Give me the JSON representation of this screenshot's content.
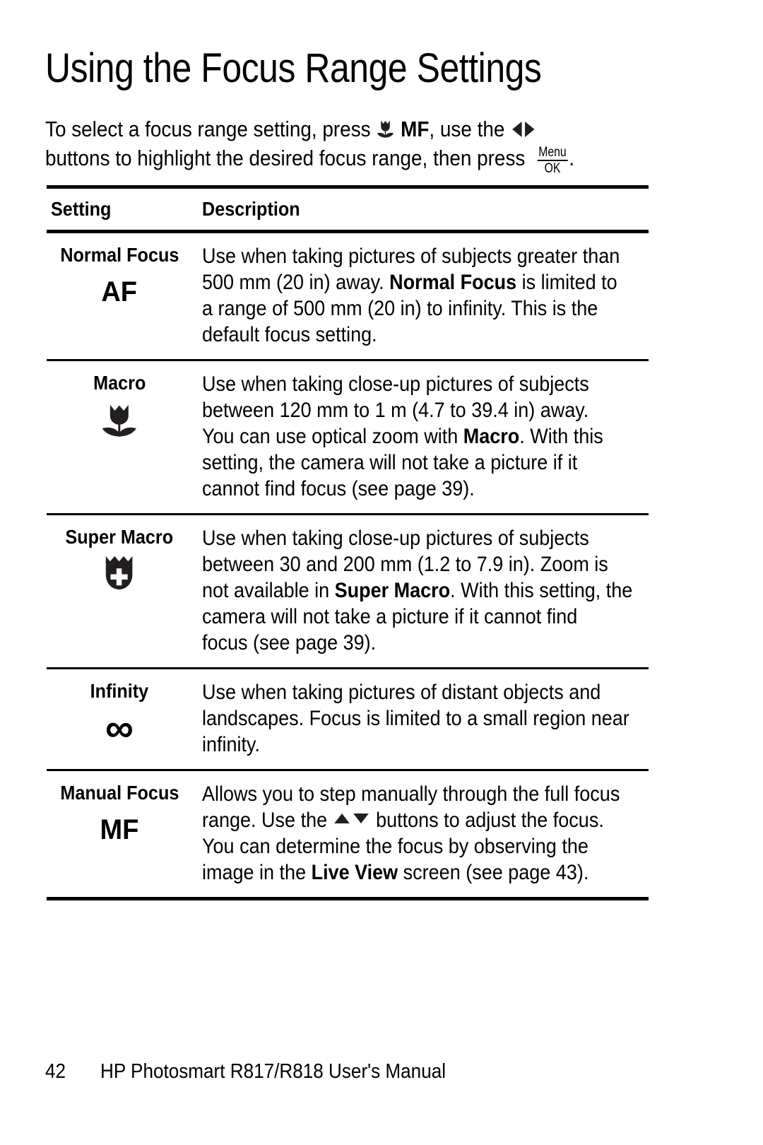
{
  "page": {
    "title": "Using the Focus Range Settings",
    "intro": {
      "line1_a": "To select a focus range setting, press",
      "line1_icon_macro": "macro-tulip-icon",
      "line1_b": "MF",
      "line1_c": ", use the",
      "line1_icon_leftright": "left-right-arrows-icon",
      "line2_a": "buttons to highlight the desired focus range, then press",
      "line2_icon_menuok_top": "Menu",
      "line2_icon_menuok_bottom": "OK",
      "line2_b": "."
    },
    "table": {
      "headers": {
        "setting": "Setting",
        "description": "Description"
      },
      "rows": [
        {
          "setting": "Normal Focus",
          "icon": "AF",
          "icon_kind": "text",
          "description_lines": [
            [
              {
                "t": "Use when taking pictures of subjects greater than",
                "b": false
              }
            ],
            [
              {
                "t": "500 mm (20 in) away. ",
                "b": false
              },
              {
                "t": "Normal Focus",
                "b": true
              },
              {
                "t": " is limited to",
                "b": false
              }
            ],
            [
              {
                "t": "a range of 500 mm (20 in) to infinity. This is the",
                "b": false
              }
            ],
            [
              {
                "t": "default focus setting.",
                "b": false
              }
            ]
          ]
        },
        {
          "setting": "Macro",
          "icon": "macro-tulip-icon",
          "icon_kind": "tulip",
          "description_lines": [
            [
              {
                "t": "Use when taking close-up pictures of subjects",
                "b": false
              }
            ],
            [
              {
                "t": "between 120 mm to 1 m (4.7 to 39.4 in) away.",
                "b": false
              }
            ],
            [
              {
                "t": "You can use optical zoom with ",
                "b": false
              },
              {
                "t": "Macro",
                "b": true
              },
              {
                "t": ". With this",
                "b": false
              }
            ],
            [
              {
                "t": "setting, the camera will not take a picture if it",
                "b": false
              }
            ],
            [
              {
                "t": "cannot find focus (see page 39).",
                "b": false
              }
            ]
          ]
        },
        {
          "setting": "Super Macro",
          "icon": "super-macro-tulip-plus-icon",
          "icon_kind": "tulip-plus",
          "description_lines": [
            [
              {
                "t": "Use when taking close-up pictures of subjects",
                "b": false
              }
            ],
            [
              {
                "t": "between 30 and 200 mm (1.2 to 7.9 in). Zoom is",
                "b": false
              }
            ],
            [
              {
                "t": "not available in ",
                "b": false
              },
              {
                "t": "Super Macro",
                "b": true
              },
              {
                "t": ". With this setting, the",
                "b": false
              }
            ],
            [
              {
                "t": "camera will not take a picture if it cannot find",
                "b": false
              }
            ],
            [
              {
                "t": "focus (see page 39).",
                "b": false
              }
            ]
          ]
        },
        {
          "setting": "Infinity",
          "icon": "∞",
          "icon_kind": "infinity",
          "description_lines": [
            [
              {
                "t": "Use when taking pictures of distant objects and",
                "b": false
              }
            ],
            [
              {
                "t": "landscapes. Focus is limited to a small region near",
                "b": false
              }
            ],
            [
              {
                "t": "infinity.",
                "b": false
              }
            ]
          ]
        },
        {
          "setting": "Manual Focus",
          "icon": "MF",
          "icon_kind": "text",
          "description_lines": [
            [
              {
                "t": "Allows you to step manually through the full focus",
                "b": false
              }
            ],
            [
              {
                "t": "range. Use the ",
                "b": false
              },
              {
                "icon": "up-down-arrows-icon"
              },
              {
                "t": " buttons to adjust the focus.",
                "b": false
              }
            ],
            [
              {
                "t": "You can determine the focus by observing the",
                "b": false
              }
            ],
            [
              {
                "t": "image in the ",
                "b": false
              },
              {
                "t": "Live View",
                "b": true
              },
              {
                "t": " screen (see page 43).",
                "b": false
              }
            ]
          ]
        }
      ]
    },
    "footer": {
      "page_number": "42",
      "text": "HP Photosmart R817/R818 User's Manual"
    }
  },
  "colors": {
    "text": "#000000",
    "background": "#ffffff",
    "rule": "#000000"
  }
}
